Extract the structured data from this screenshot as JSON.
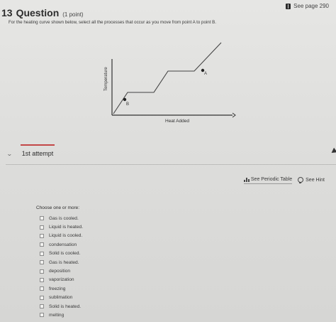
{
  "question": {
    "number": "13",
    "title": "Question",
    "points": "(1 point)",
    "see_page": "See page 290",
    "prompt": "For the heating curve shown below, select all the processes that occur as you move from point A to point B."
  },
  "graph": {
    "ylabel": "Temperature",
    "xlabel": "Heat Added",
    "point_a": "A",
    "point_b": "B"
  },
  "attempt": {
    "label": "1st attempt"
  },
  "tools": {
    "periodic_table": "See Periodic Table",
    "hint": "See Hint"
  },
  "answer": {
    "instruction": "Choose one or more:",
    "options": [
      "Gas is cooled.",
      "Liquid is heated.",
      "Liquid is cooled.",
      "condensation",
      "Solid is cooled.",
      "Gas is heated.",
      "deposition",
      "vaporization",
      "freezing",
      "sublimation",
      "Solid is heated.",
      "melting"
    ]
  }
}
